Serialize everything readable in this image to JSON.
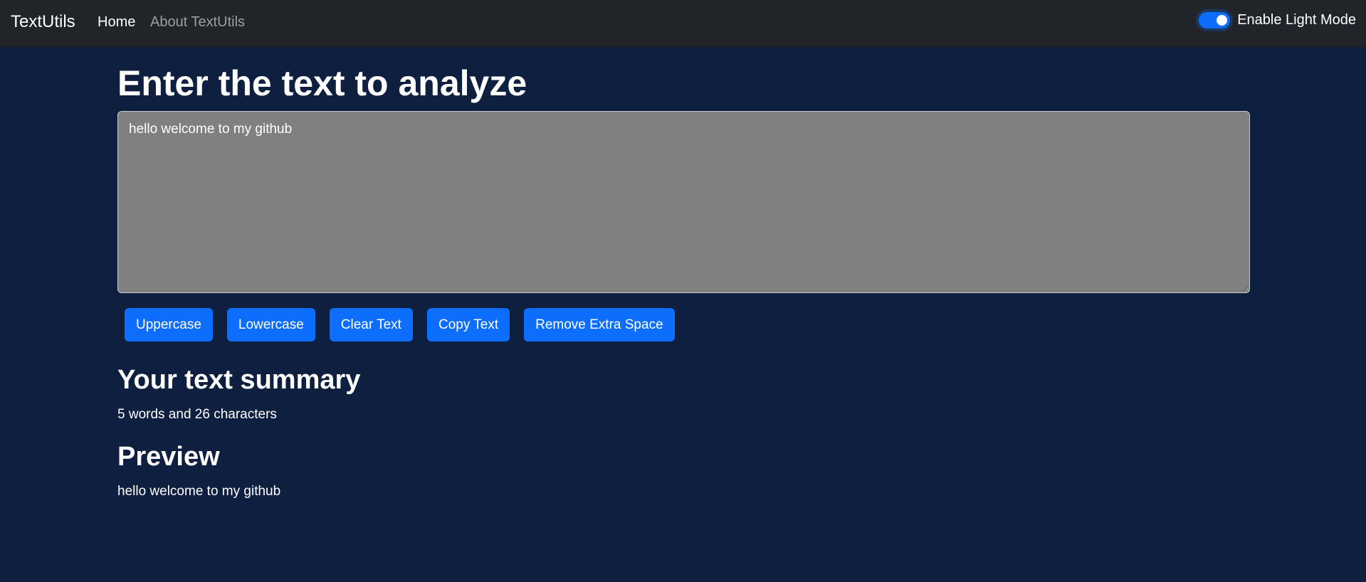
{
  "navbar": {
    "brand": "TextUtils",
    "links": [
      "Home",
      "About TextUtils"
    ],
    "toggle_label": "Enable Light Mode",
    "toggle_on": true
  },
  "main": {
    "heading": "Enter the text to analyze",
    "textarea_value": "hello welcome to my github",
    "buttons": [
      "Uppercase",
      "Lowercase",
      "Clear Text",
      "Copy Text",
      "Remove Extra Space"
    ],
    "summary_heading": "Your text summary",
    "summary_text": "5 words and 26 characters",
    "preview_heading": "Preview",
    "preview_text": "hello welcome to my github"
  },
  "colors": {
    "page_bg": "#0f1f40",
    "navbar_bg": "#212529",
    "accent": "#0d6efd",
    "textarea_bg": "#808080"
  }
}
